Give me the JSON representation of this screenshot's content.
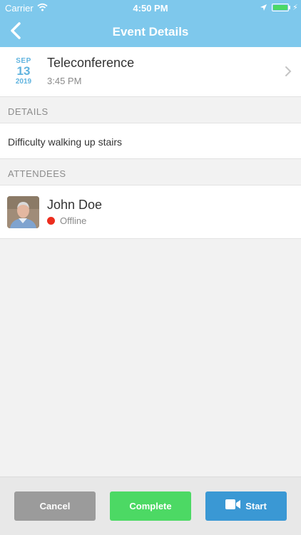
{
  "status_bar": {
    "carrier": "Carrier",
    "time": "4:50 PM"
  },
  "nav": {
    "title": "Event Details",
    "back_icon": "chevron-left-icon"
  },
  "event": {
    "month": "SEP",
    "day": "13",
    "year": "2019",
    "name": "Teleconference",
    "time": "3:45 PM"
  },
  "details": {
    "header": "DETAILS",
    "text": "Difficulty walking up stairs"
  },
  "attendees": {
    "header": "ATTENDEES",
    "items": [
      {
        "name": "John Doe",
        "status": "Offline",
        "status_color": "#ec2d1e"
      }
    ]
  },
  "footer": {
    "cancel_label": "Cancel",
    "complete_label": "Complete",
    "start_label": "Start",
    "start_icon": "video-camera-icon"
  },
  "colors": {
    "nav_bg": "#7ec8ec",
    "date_accent": "#5fb3df",
    "cancel": "#9b9b9b",
    "complete": "#4cd964",
    "start": "#3a98d4"
  }
}
